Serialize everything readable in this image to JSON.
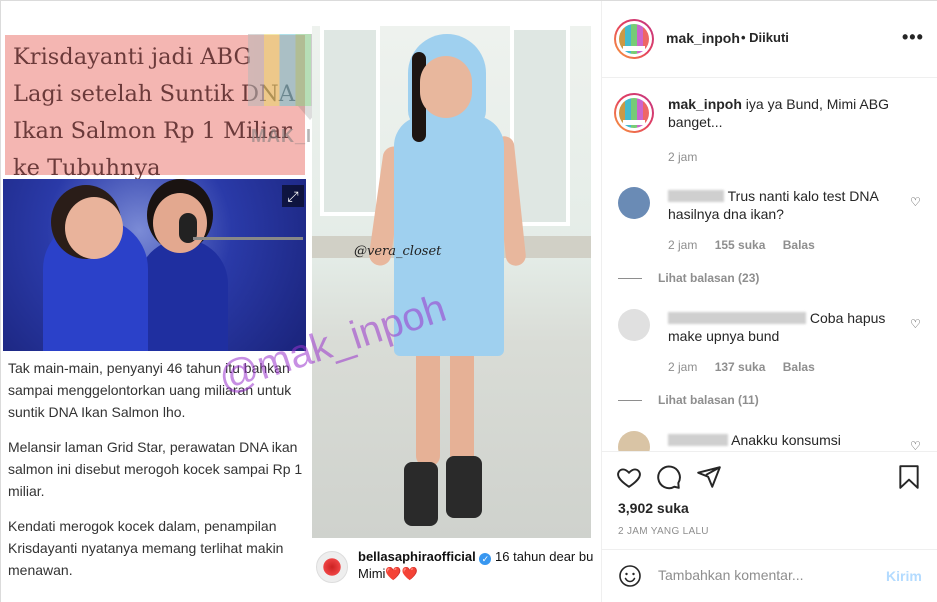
{
  "media": {
    "headline": "Krisdayanti jadi ABG Lagi setelah Suntik DNA Ikan Salmon Rp 1 Miliar ke Tubuhnya",
    "logo_text": "MAK_INPOH",
    "expand_icon": "expand-arrows-icon",
    "article": [
      "Tak main-main, penyanyi 46 tahun itu bahkan sampai menggelontorkan uang miliaran untuk suntik DNA Ikan Salmon lho.",
      "Melansir laman Grid Star, perawatan DNA ikan salmon ini disebut merogoh kocek sampai Rp 1 miliar.",
      "Kendati merogok kocek dalam, penampilan Krisdayanti nyatanya memang terlihat makin menawan."
    ],
    "photo_credit": "@vera_closet",
    "watermark": "@mak_inpoh",
    "repost": {
      "username": "bellasaphiraofficial",
      "caption": "16 tahun dear bu Mimi❤️❤️"
    }
  },
  "header": {
    "username": "mak_inpoh",
    "follow_status": "• Diikuti",
    "more_icon": "more-dots-icon"
  },
  "comments": [
    {
      "username": "mak_inpoh",
      "text": "iya ya Bund, Mimi ABG banget...",
      "time": "2 jam"
    },
    {
      "username": "",
      "text": "Trus nanti kalo test DNA hasilnya dna ikan?",
      "time": "2 jam",
      "likes": "155 suka",
      "reply": "Balas",
      "view_replies": "Lihat balasan (23)"
    },
    {
      "username": "",
      "text": "Coba hapus make upnya bund",
      "time": "2 jam",
      "likes": "137 suka",
      "reply": "Balas",
      "view_replies": "Lihat balasan (11)"
    },
    {
      "username": "",
      "text": "Anakku konsumsi"
    }
  ],
  "actions": {
    "like_icon": "heart-icon",
    "comment_icon": "comment-bubble-icon",
    "share_icon": "paper-plane-icon",
    "save_icon": "bookmark-icon",
    "likes": "3,902 suka",
    "time_ago": "2 JAM YANG LALU"
  },
  "add_comment": {
    "emoji_icon": "emoji-smile-icon",
    "placeholder": "Tambahkan komentar...",
    "post_label": "Kirim"
  },
  "colors": {
    "headline_bg": "#f4b6b2",
    "watermark": "#9933cc",
    "link_disabled": "#b3dbff",
    "verified": "#3897f0"
  }
}
